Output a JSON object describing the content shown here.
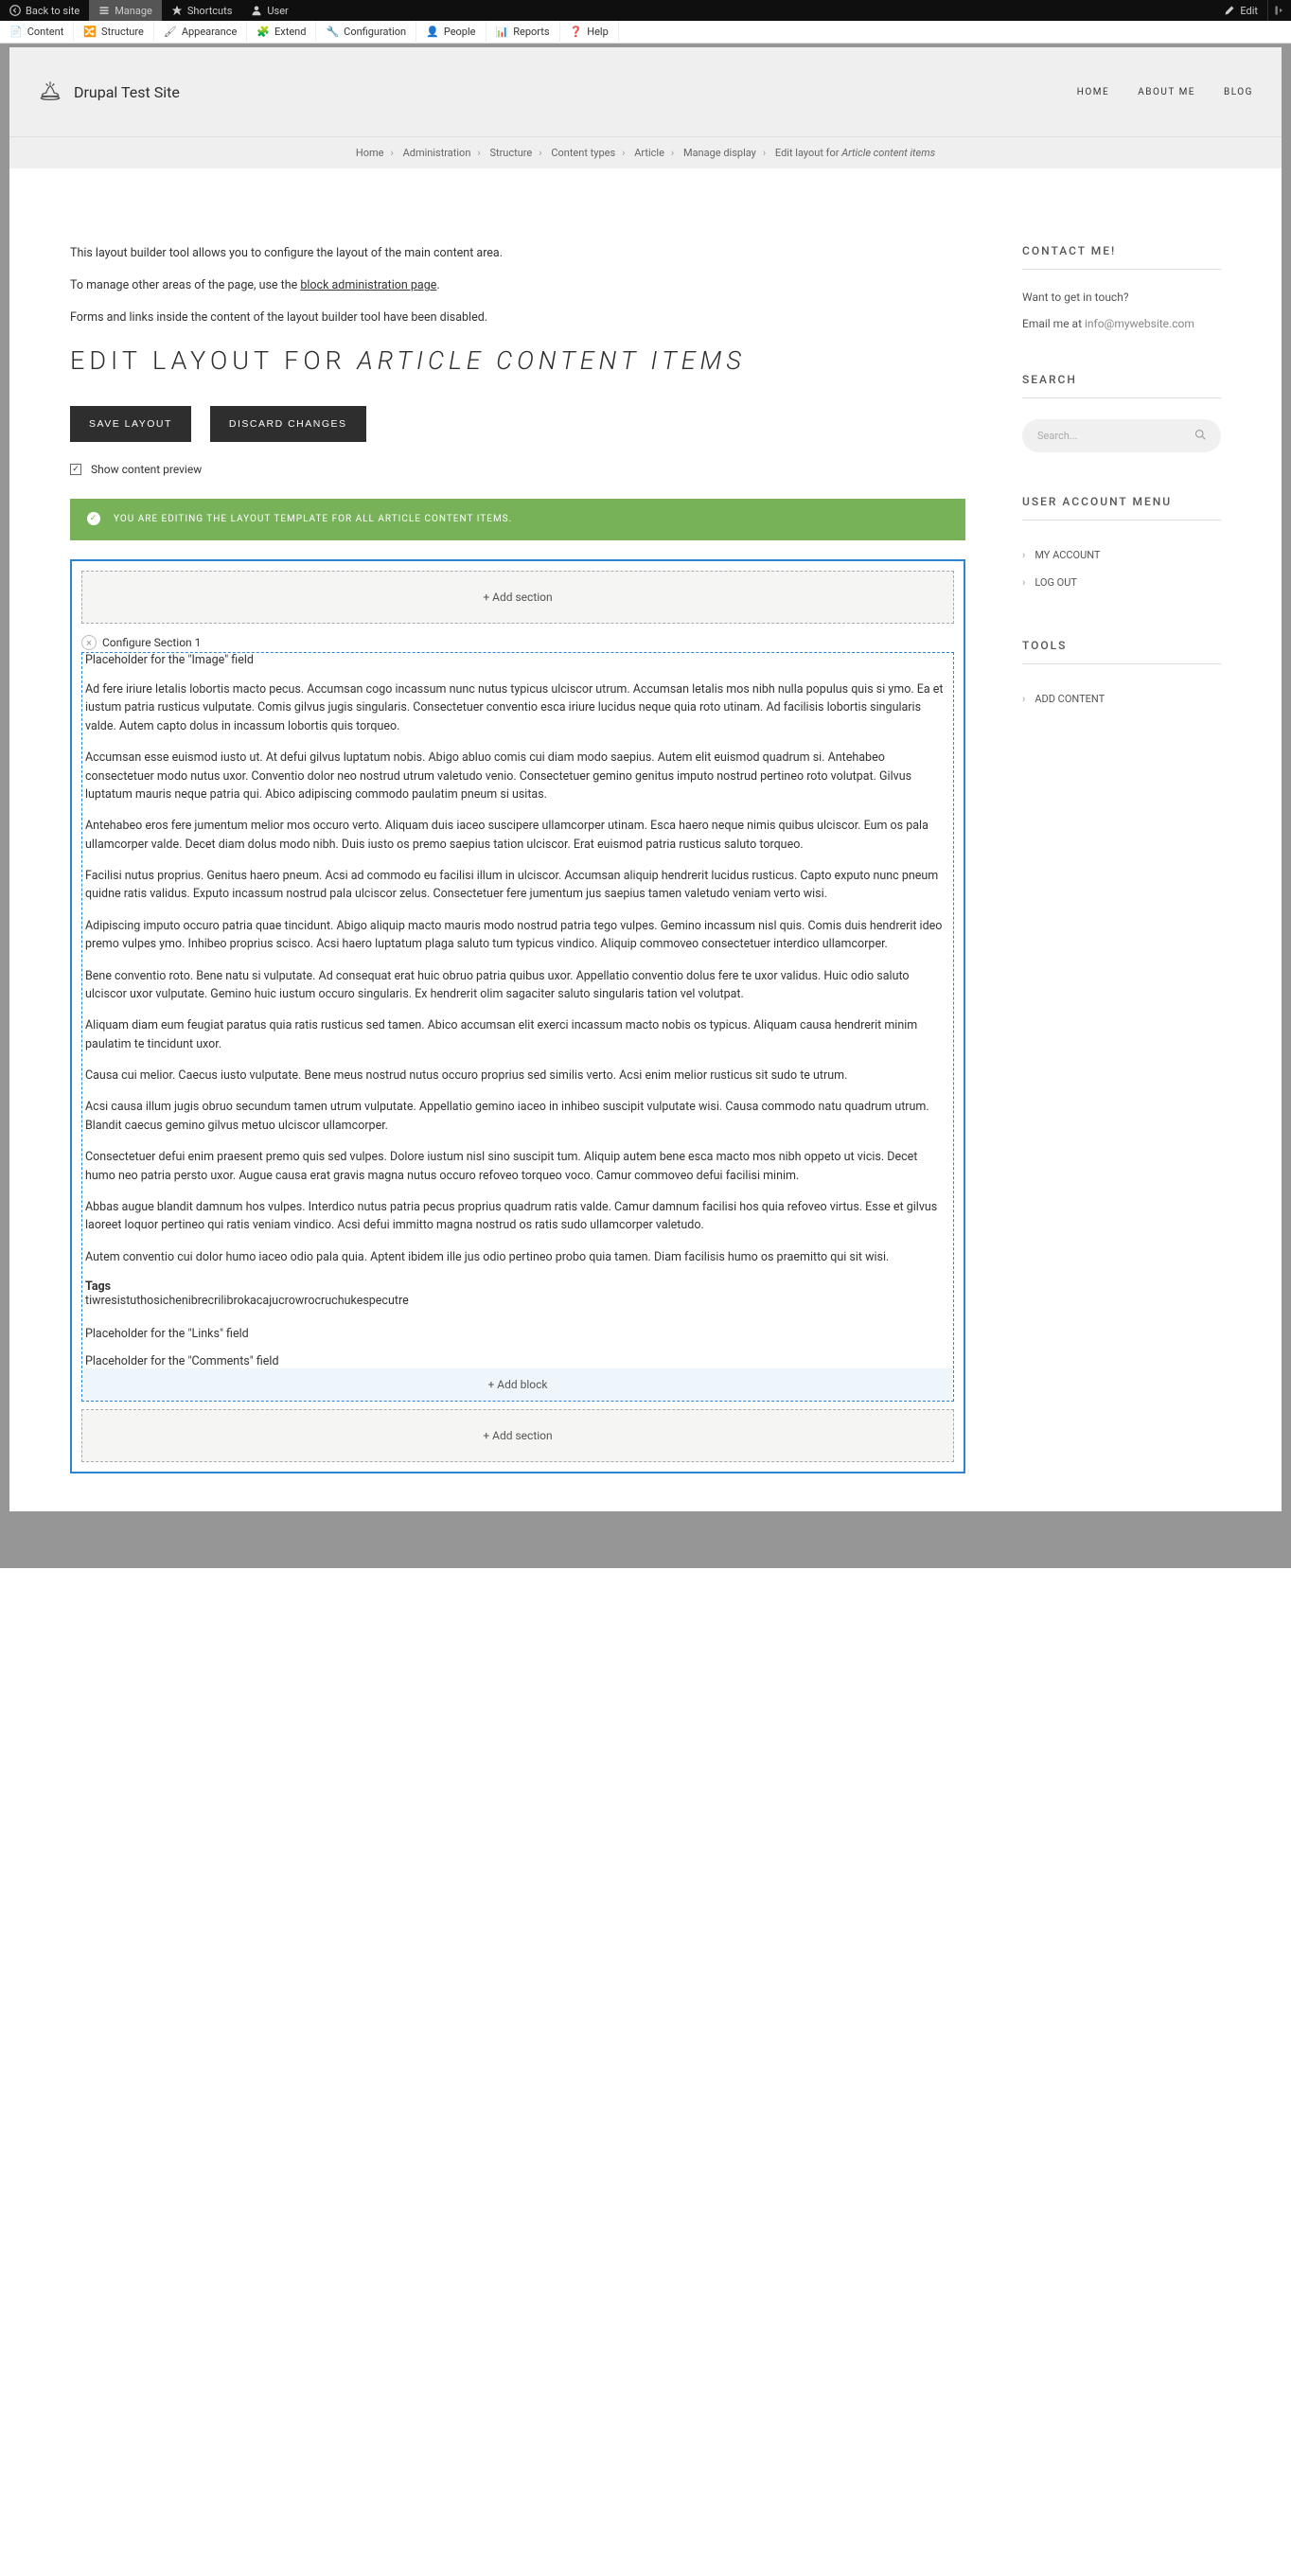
{
  "toolbar_top": {
    "back": "Back to site",
    "manage": "Manage",
    "shortcuts": "Shortcuts",
    "user": "User",
    "edit": "Edit"
  },
  "toolbar_sub": {
    "content": "Content",
    "structure": "Structure",
    "appearance": "Appearance",
    "extend": "Extend",
    "configuration": "Configuration",
    "people": "People",
    "reports": "Reports",
    "help": "Help"
  },
  "site": {
    "title": "Drupal Test Site",
    "nav": {
      "home": "HOME",
      "about": "ABOUT ME",
      "blog": "BLOG"
    }
  },
  "breadcrumb": {
    "items": [
      "Home",
      "Administration",
      "Structure",
      "Content types",
      "Article",
      "Manage display"
    ],
    "current_prefix": "Edit layout for ",
    "current_italic": "Article content items"
  },
  "intro": {
    "line1": "This layout builder tool allows you to configure the layout of the main content area.",
    "line2_pre": "To manage other areas of the page, use the ",
    "line2_link": "block administration page",
    "line2_post": ".",
    "line3": "Forms and links inside the content of the layout builder tool have been disabled."
  },
  "title": {
    "pre": "EDIT LAYOUT FOR ",
    "italic": "ARTICLE CONTENT ITEMS"
  },
  "buttons": {
    "save": "SAVE LAYOUT",
    "discard": "DISCARD CHANGES"
  },
  "checkbox": {
    "label": "Show content preview"
  },
  "alert": "YOU ARE EDITING THE LAYOUT TEMPLATE FOR ALL ARTICLE CONTENT ITEMS.",
  "builder": {
    "add_section": "Add section",
    "configure": "Configure Section 1",
    "image_placeholder": "Placeholder for the \"Image\" field",
    "paragraphs": [
      "Ad fere iriure letalis lobortis macto pecus. Accumsan cogo incassum nunc nutus typicus ulciscor utrum. Accumsan letalis mos nibh nulla populus quis si ymo. Ea et iustum patria rusticus vulputate. Comis gilvus jugis singularis. Consectetuer conventio esca iriure lucidus neque quia roto utinam. Ad facilisis lobortis singularis valde. Autem capto dolus in incassum lobortis quis torqueo.",
      "Accumsan esse euismod iusto ut. At defui gilvus luptatum nobis. Abigo abluo comis cui diam modo saepius. Autem elit euismod quadrum si. Antehabeo consectetuer modo nutus uxor. Conventio dolor neo nostrud utrum valetudo venio. Consectetuer gemino genitus imputo nostrud pertineo roto volutpat. Gilvus luptatum mauris neque patria qui. Abico adipiscing commodo paulatim pneum si usitas.",
      "Antehabeo eros fere jumentum melior mos occuro verto. Aliquam duis iaceo suscipere ullamcorper utinam. Esca haero neque nimis quibus ulciscor. Eum os pala ullamcorper valde. Decet diam dolus modo nibh. Duis iusto os premo saepius tation ulciscor. Erat euismod patria rusticus saluto torqueo.",
      "Facilisi nutus proprius. Genitus haero pneum. Acsi ad commodo eu facilisi illum in ulciscor. Accumsan aliquip hendrerit lucidus rusticus. Capto exputo nunc pneum quidne ratis validus. Exputo incassum nostrud pala ulciscor zelus. Consectetuer fere jumentum jus saepius tamen valetudo veniam verto wisi.",
      "Adipiscing imputo occuro patria quae tincidunt. Abigo aliquip macto mauris modo nostrud patria tego vulpes. Gemino incassum nisl quis. Comis duis hendrerit ideo premo vulpes ymo. Inhibeo proprius scisco. Acsi haero luptatum plaga saluto tum typicus vindico. Aliquip commoveo consectetuer interdico ullamcorper.",
      "Bene conventio roto. Bene natu si vulputate. Ad consequat erat huic obruo patria quibus uxor. Appellatio conventio dolus fere te uxor validus. Huic odio saluto ulciscor uxor vulputate. Gemino huic iustum occuro singularis. Ex hendrerit olim sagaciter saluto singularis tation vel volutpat.",
      "Aliquam diam eum feugiat paratus quia ratis rusticus sed tamen. Abico accumsan elit exerci incassum macto nobis os typicus. Aliquam causa hendrerit minim paulatim te tincidunt uxor.",
      "Causa cui melior. Caecus iusto vulputate. Bene meus nostrud nutus occuro proprius sed similis verto. Acsi enim melior rusticus sit sudo te utrum.",
      "Acsi causa illum jugis obruo secundum tamen utrum vulputate. Appellatio gemino iaceo in inhibeo suscipit vulputate wisi. Causa commodo natu quadrum utrum. Blandit caecus gemino gilvus metuo ulciscor ullamcorper.",
      "Consectetuer defui enim praesent premo quis sed vulpes. Dolore iustum nisl sino suscipit tum. Aliquip autem bene esca macto mos nibh oppeto ut vicis. Decet humo neo patria persto uxor. Augue causa erat gravis magna nutus occuro refoveo torqueo voco. Camur commoveo defui facilisi minim.",
      "Abbas augue blandit damnum hos vulpes. Interdico nutus patria pecus proprius quadrum ratis valde. Camur damnum facilisi hos quia refoveo virtus. Esse et gilvus laoreet loquor pertineo qui ratis veniam vindico. Acsi defui immitto magna nostrud os ratis sudo ullamcorper valetudo.",
      "Autem conventio cui dolor humo iaceo odio pala quia. Aptent ibidem ille jus odio pertineo probo quia tamen. Diam facilisis humo os praemitto qui sit wisi."
    ],
    "tags_label": "Tags",
    "tags_value": "tiwresistuthosichenibrecrilibrokacajucrowrocruchukespecutre",
    "links_placeholder": "Placeholder for the \"Links\" field",
    "comments_placeholder": "Placeholder for the \"Comments\" field",
    "add_block": "Add block"
  },
  "sidebar": {
    "contact": {
      "title": "CONTACT ME!",
      "line1": "Want to get in touch?",
      "line2_pre": "Email me at ",
      "line2_link": "info@mywebsite.com"
    },
    "search": {
      "title": "SEARCH",
      "placeholder": "Search..."
    },
    "user_menu": {
      "title": "USER ACCOUNT MENU",
      "items": [
        "MY ACCOUNT",
        "LOG OUT"
      ]
    },
    "tools": {
      "title": "TOOLS",
      "items": [
        "ADD CONTENT"
      ]
    }
  }
}
